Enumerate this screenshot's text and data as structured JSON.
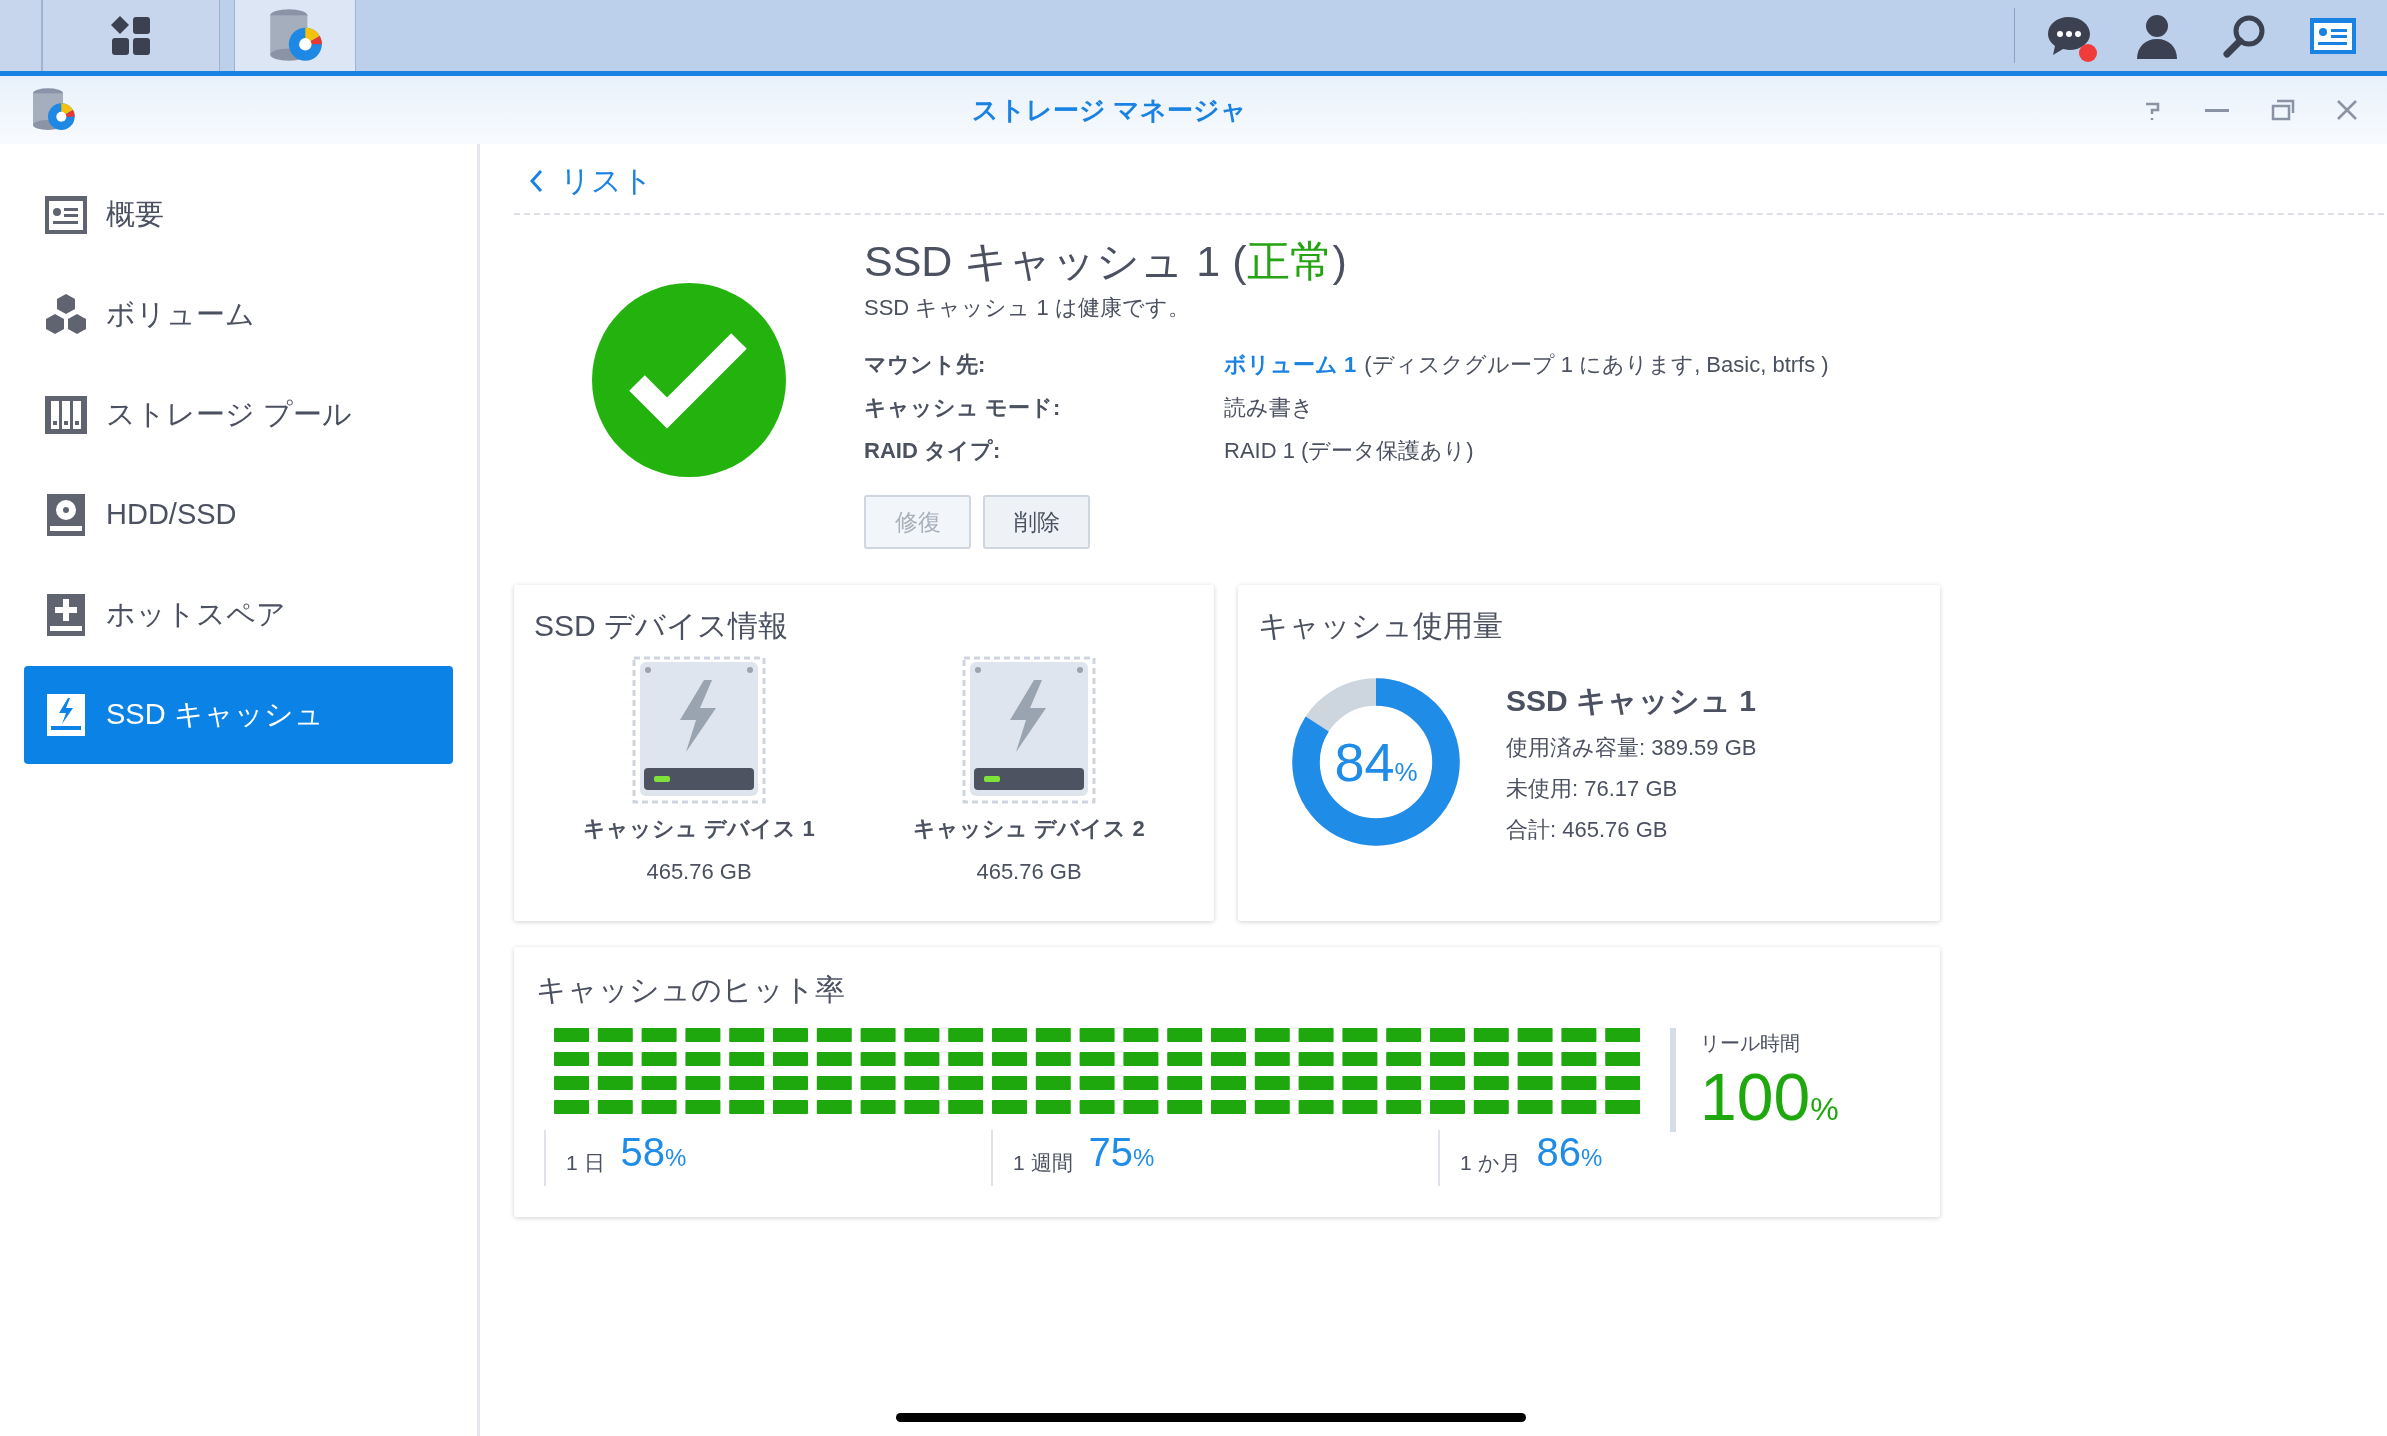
{
  "taskbar": {
    "tabs": [
      {
        "kind": "main-menu",
        "selected": false
      },
      {
        "kind": "storage",
        "selected": true
      }
    ],
    "chat_unread": true
  },
  "window": {
    "title": "ストレージ マネージャ"
  },
  "sidebar": {
    "items": [
      {
        "label": "概要",
        "kind": "overview",
        "selected": false
      },
      {
        "label": "ボリューム",
        "kind": "volume",
        "selected": false
      },
      {
        "label": "ストレージ プール",
        "kind": "pool",
        "selected": false
      },
      {
        "label": "HDD/SSD",
        "kind": "disk",
        "selected": false
      },
      {
        "label": "ホットスペア",
        "kind": "spare",
        "selected": false
      },
      {
        "label": "SSD キャッシュ",
        "kind": "cache",
        "selected": true
      }
    ]
  },
  "back_link": "リスト",
  "cache": {
    "title_prefix": "SSD キャッシュ 1 (",
    "status": "正常",
    "title_suffix": ")",
    "healthy": true,
    "description": "SSD キャッシュ 1 は健康です。",
    "details": [
      {
        "label": "マウント先:",
        "link": "ボリューム 1",
        "value": "(ディスクグループ 1 にあります, Basic, btrfs )"
      },
      {
        "label": "キャッシュ モード:",
        "value": "読み書き"
      },
      {
        "label": "RAID タイプ:",
        "value": "RAID 1 (データ保護あり)"
      }
    ],
    "buttons": [
      {
        "label": "修復",
        "disabled": true
      },
      {
        "label": "削除",
        "disabled": false
      }
    ]
  },
  "devices": {
    "title": "SSD デバイス情報",
    "items": [
      {
        "name": "キャッシュ デバイス 1",
        "size": "465.76 GB"
      },
      {
        "name": "キャッシュ デバイス 2",
        "size": "465.76 GB"
      }
    ]
  },
  "usage": {
    "title": "キャッシュ使用量",
    "percent": "84",
    "unit": "%",
    "level": 0.84,
    "name": "SSD キャッシュ 1",
    "lines": [
      "使用済み容量: 389.59 GB",
      "未使用: 76.17 GB",
      "合計: 465.76 GB"
    ]
  },
  "hit_rate": {
    "title": "キャッシュのヒット率",
    "periods": [
      {
        "label": "1 日",
        "value": "58",
        "unit": "%"
      },
      {
        "label": "1 週間",
        "value": "75",
        "unit": "%"
      },
      {
        "label": "1 か月",
        "value": "86",
        "unit": "%"
      }
    ],
    "realtime": {
      "label": "リール時間",
      "value": "100",
      "unit": "%"
    }
  }
}
